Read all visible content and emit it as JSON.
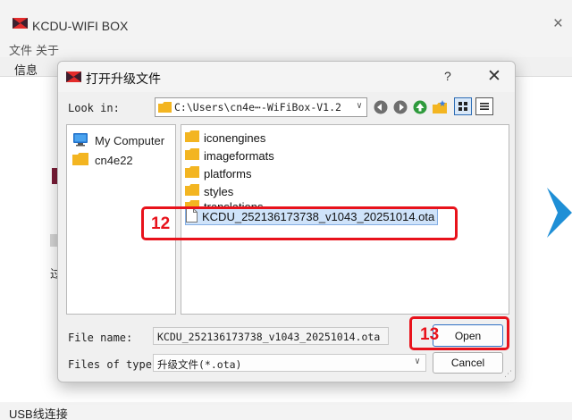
{
  "main": {
    "title": "KCDU-WIFI BOX",
    "close_glyph": "×",
    "menu": [
      "文件",
      "关于"
    ],
    "tab": "信息",
    "side_char": "过",
    "status": "USB线连接",
    "colors": {
      "flag_red": "#e32b2b",
      "flag_dark": "#3d1f2e",
      "arrow_blue": "#1f8fd6"
    }
  },
  "dialog": {
    "title": "打开升级文件",
    "help": "?",
    "close": "✕",
    "look_in_label": "Look in:",
    "look_in_path": "C:\\Users\\cn4e⋯-WiFiBox-V1.2",
    "nav_icons": [
      "back-icon",
      "forward-icon",
      "up-icon",
      "new-folder-icon",
      "detail-view-icon",
      "list-view-icon"
    ],
    "sidebar": [
      {
        "label": "My Computer",
        "icon": "computer-icon"
      },
      {
        "label": "cn4e22",
        "icon": "folder-icon"
      }
    ],
    "files": [
      {
        "label": "iconengines",
        "type": "folder"
      },
      {
        "label": "imageformats",
        "type": "folder"
      },
      {
        "label": "platforms",
        "type": "folder"
      },
      {
        "label": "styles",
        "type": "folder"
      },
      {
        "label": "translations",
        "type": "folder"
      },
      {
        "label": "KCDU_252136173738_v1043_20251014.ota",
        "type": "file",
        "selected": true
      }
    ],
    "file_name_label": "File name:",
    "file_name_value": "KCDU_252136173738_v1043_20251014.ota",
    "files_of_type_label": "Files of type:",
    "files_of_type_value": "升级文件(*.ota)",
    "open_label": "Open",
    "cancel_label": "Cancel",
    "annotations": {
      "step_file": "12",
      "step_open": "13",
      "color": "#e8121b"
    }
  }
}
